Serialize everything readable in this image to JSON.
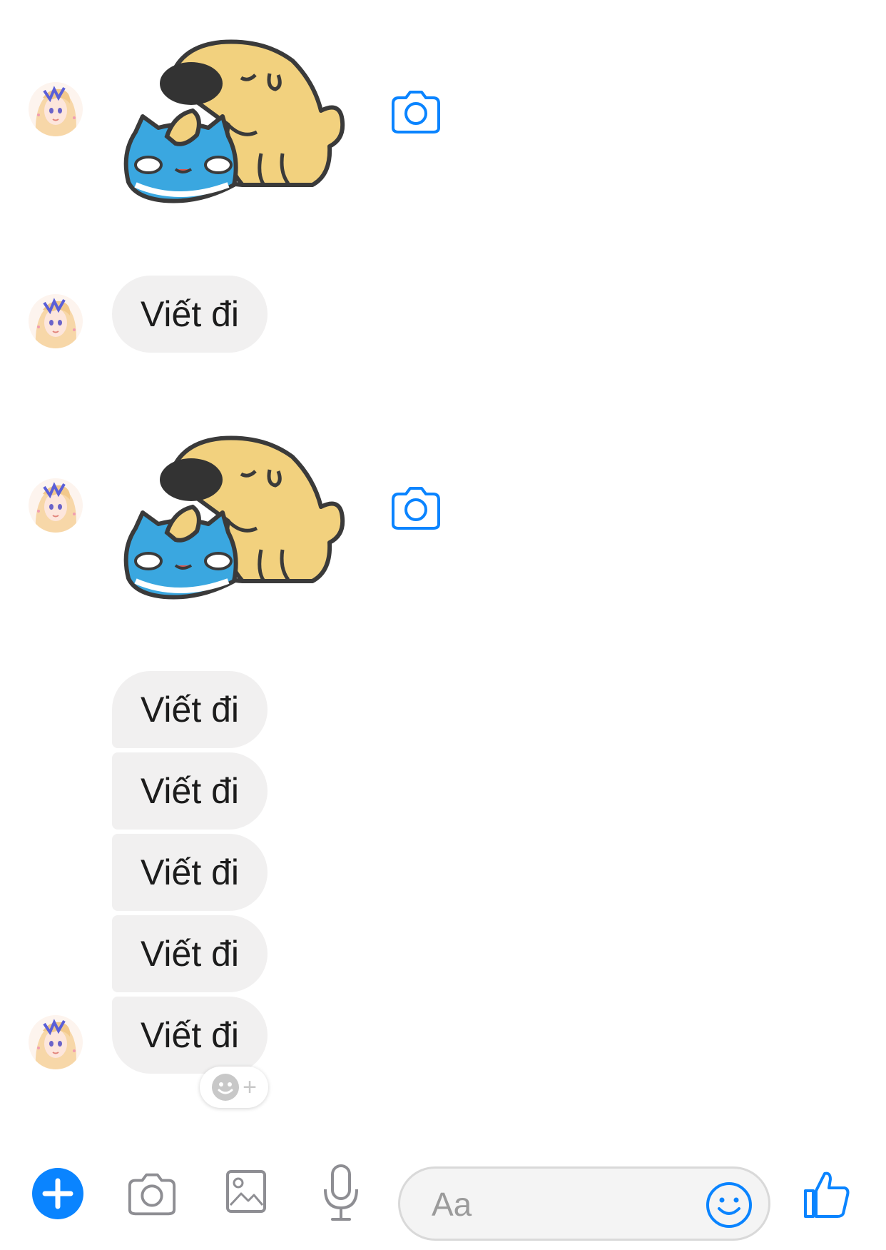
{
  "colors": {
    "accent": "#0a84ff",
    "bubble_bg": "#f1f0f0",
    "bubble_text": "#1c1c1c",
    "icon_gray": "#8e8e93"
  },
  "messages": [
    {
      "type": "sticker",
      "sticker": "dog-hugging-cat-sticker",
      "avatar": true
    },
    {
      "type": "text",
      "text": "Viết đi",
      "avatar": true
    },
    {
      "type": "sticker",
      "sticker": "dog-hugging-cat-sticker",
      "avatar": true
    },
    {
      "type": "text",
      "text": "Viết đi",
      "avatar": false
    },
    {
      "type": "text",
      "text": "Viết đi",
      "avatar": false
    },
    {
      "type": "text",
      "text": "Viết đi",
      "avatar": false
    },
    {
      "type": "text",
      "text": "Viết đi",
      "avatar": false
    },
    {
      "type": "text",
      "text": "Viết đi",
      "avatar": true
    }
  ],
  "reaction_button": {
    "icon": "smiley-plus-icon",
    "plus": "+"
  },
  "composer": {
    "placeholder": "Aa",
    "icons": [
      "plus-icon",
      "camera-icon",
      "gallery-icon",
      "microphone-icon",
      "emoji-icon",
      "like-icon"
    ]
  }
}
